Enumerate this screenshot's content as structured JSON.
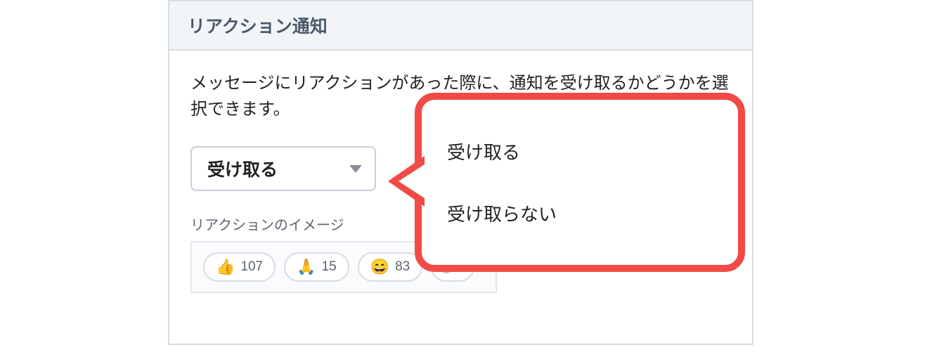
{
  "panel": {
    "title": "リアクション通知",
    "description": "メッセージにリアクションがあった際に、通知を受け取るかどうかを選択できます。",
    "select": {
      "value": "受け取る"
    },
    "sub_label": "リアクションのイメージ",
    "reactions": [
      {
        "emoji": "👍",
        "count": "107",
        "name": "thumbs-up"
      },
      {
        "emoji": "🙏",
        "count": "15",
        "name": "pray"
      },
      {
        "emoji": "😄",
        "count": "83",
        "name": "grin"
      }
    ]
  },
  "callout": {
    "options": [
      "受け取る",
      "受け取らない"
    ]
  },
  "colors": {
    "accent_red": "#f24a46",
    "panel_border": "#d6dde4",
    "header_bg": "#f2f5f8"
  }
}
